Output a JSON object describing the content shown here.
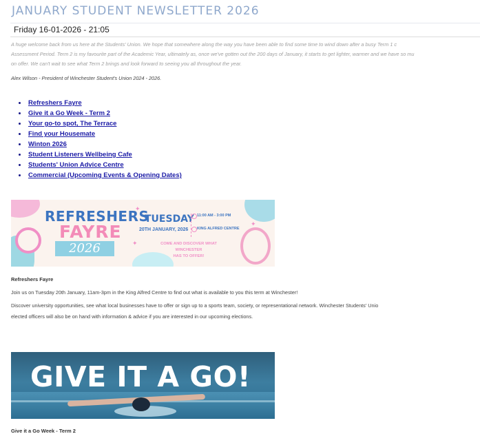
{
  "newsletter": {
    "title": "JANUARY STUDENT NEWSLETTER 2026",
    "date": "Friday 16-01-2026 - 21:05",
    "intro_lines": [
      "A huge welcome back from us here at the Students' Union. We hope that somewhere along the way you have been able to find some time to wind down after a busy Term 1 c",
      "Assessment Period. Term 2 is my favourite part of the Academic Year, ultimately as, once we've gotten out the 200 days of January, it starts to get lighter, warmer and we have so mu",
      "on offer. We can't wait to see what Term 2 brings and look forward to seeing you all throughout the year."
    ],
    "signature": "Alex Wilson - President of Winchester Student's Union 2024 - 2026.",
    "links": [
      "Refreshers Fayre",
      "Give it a Go Week - Term 2",
      "Your go-to spot, The Terrace",
      "Find your Housemate",
      "Winton 2026",
      "Student Listeners Wellbeing Cafe",
      "Students' Union Advice Centre",
      "Commercial (Upcoming Events & Opening Dates)"
    ]
  },
  "refreshers_banner": {
    "word1": "REFRESHERS",
    "word2": "FAYRE",
    "year": "2026",
    "day": "TUESDAY",
    "date": "20TH JANUARY, 2026",
    "time": "11:00 AM - 3:00 PM",
    "venue": "KING ALFRED CENTRE",
    "cta_line1": "COME AND DISCOVER WHAT WINCHESTER",
    "cta_line2": "HAS TO OFFER!"
  },
  "refreshers_section": {
    "heading": "Refreshers Fayre",
    "para1": "Join us on Tuesday 20th January, 11am-3pm in the King Alfred Centre to find out what is available to you this term at Winchester!",
    "para2_line1": "Discover university opportunities, see what local businesses have to offer or sign up to a sports team, society, or representational network. Winchester Students' Unio",
    "para2_line2": "elected officers will also be on hand with information & advice if you are interested in our upcoming elections."
  },
  "giveitago_banner": {
    "text": "GIVE IT A GO!"
  },
  "giveitago_section": {
    "heading": "Give it a Go Week - Term 2"
  }
}
